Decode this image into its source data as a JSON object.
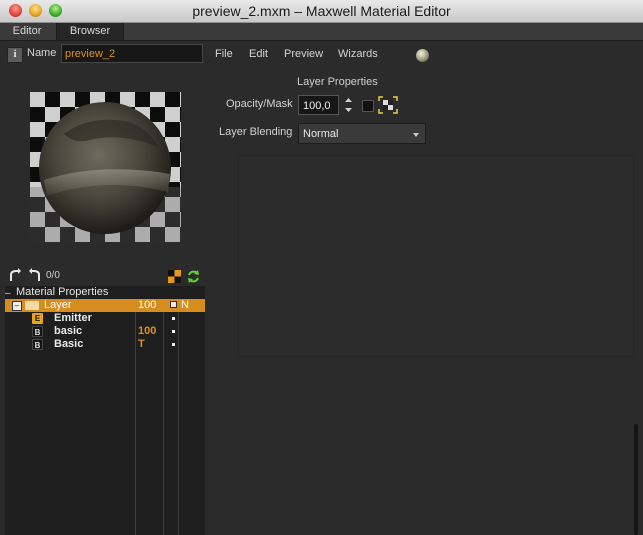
{
  "window": {
    "title": "preview_2.mxm – Maxwell Material Editor"
  },
  "tabs": [
    {
      "label": "Editor"
    },
    {
      "label": "Browser"
    }
  ],
  "name_field": {
    "label": "Name",
    "value": "preview_2"
  },
  "menu": [
    {
      "label": "File"
    },
    {
      "label": "Edit"
    },
    {
      "label": "Preview"
    },
    {
      "label": "Wizards"
    }
  ],
  "history": {
    "counter": "0/0"
  },
  "tree": {
    "title": "Material Properties",
    "rows": [
      {
        "name": "Layer",
        "value": "100",
        "flag": "N"
      },
      {
        "badge": "E",
        "name": "Emitter",
        "value": ""
      },
      {
        "badge": "B",
        "name": "basic",
        "value": "100"
      },
      {
        "badge": "B",
        "name": "Basic",
        "value": "T"
      }
    ]
  },
  "layer_properties": {
    "title": "Layer Properties",
    "opacity_label": "Opacity/Mask",
    "opacity_value": "100,0",
    "blending_label": "Layer Blending",
    "blending_value": "Normal"
  },
  "colors": {
    "accent": "#d78c20",
    "background": "#2b2b2b",
    "tree_bg": "#1e1e1e"
  }
}
